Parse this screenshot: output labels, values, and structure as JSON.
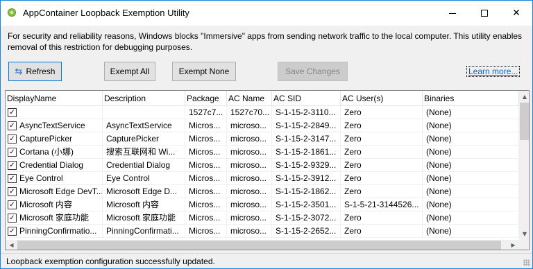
{
  "window": {
    "title": "AppContainer Loopback Exemption Utility"
  },
  "description": "For security and reliability reasons, Windows blocks \"Immersive\" apps from sending network traffic to the local computer. This utility enables removal of this restriction for debugging purposes.",
  "toolbar": {
    "refresh_label": "Refresh",
    "refresh_icon": "refresh-icon",
    "exempt_all_label": "Exempt All",
    "exempt_none_label": "Exempt None",
    "save_label": "Save Changes",
    "learn_more_label": "Learn more..."
  },
  "table": {
    "columns": [
      "DisplayName",
      "Description",
      "Package",
      "AC Name",
      "AC SID",
      "AC User(s)",
      "Binaries"
    ],
    "rows": [
      {
        "checked": true,
        "name": "",
        "description": "",
        "package": "1527c7...",
        "ac_name": "1527c70...",
        "ac_sid": "S-1-15-2-3110...",
        "ac_users": "Zero",
        "binaries": "(None)"
      },
      {
        "checked": true,
        "name": "AsyncTextService",
        "description": "AsyncTextService",
        "package": "Micros...",
        "ac_name": "microso...",
        "ac_sid": "S-1-15-2-2849...",
        "ac_users": "Zero",
        "binaries": "(None)"
      },
      {
        "checked": true,
        "name": "CapturePicker",
        "description": "CapturePicker",
        "package": "Micros...",
        "ac_name": "microso...",
        "ac_sid": "S-1-15-2-3147...",
        "ac_users": "Zero",
        "binaries": "(None)"
      },
      {
        "checked": true,
        "name": "Cortana (小娜)",
        "description": "搜索互联网和 Wi...",
        "package": "Micros...",
        "ac_name": "microso...",
        "ac_sid": "S-1-15-2-1861...",
        "ac_users": "Zero",
        "binaries": "(None)"
      },
      {
        "checked": true,
        "name": "Credential Dialog",
        "description": "Credential Dialog",
        "package": "Micros...",
        "ac_name": "microso...",
        "ac_sid": "S-1-15-2-9329...",
        "ac_users": "Zero",
        "binaries": "(None)"
      },
      {
        "checked": true,
        "name": "Eye Control",
        "description": "Eye Control",
        "package": "Micros...",
        "ac_name": "microso...",
        "ac_sid": "S-1-15-2-3912...",
        "ac_users": "Zero",
        "binaries": "(None)"
      },
      {
        "checked": true,
        "name": "Microsoft Edge DevT...",
        "description": "Microsoft Edge D...",
        "package": "Micros...",
        "ac_name": "microso...",
        "ac_sid": "S-1-15-2-1862...",
        "ac_users": "Zero",
        "binaries": "(None)"
      },
      {
        "checked": true,
        "name": "Microsoft 内容",
        "description": "Microsoft 内容",
        "package": "Micros...",
        "ac_name": "microso...",
        "ac_sid": "S-1-15-2-3501...",
        "ac_users": "S-1-5-21-3144526...",
        "binaries": "(None)"
      },
      {
        "checked": true,
        "name": "Microsoft 家庭功能",
        "description": "Microsoft 家庭功能",
        "package": "Micros...",
        "ac_name": "microso...",
        "ac_sid": "S-1-15-2-3072...",
        "ac_users": "Zero",
        "binaries": "(None)"
      },
      {
        "checked": true,
        "name": "PinningConfirmatio...",
        "description": "PinningConfirmati...",
        "package": "Micros...",
        "ac_name": "microso...",
        "ac_sid": "S-1-15-2-2652...",
        "ac_users": "Zero",
        "binaries": "(None)"
      }
    ]
  },
  "status": {
    "text": "Loopback exemption configuration successfully updated."
  }
}
